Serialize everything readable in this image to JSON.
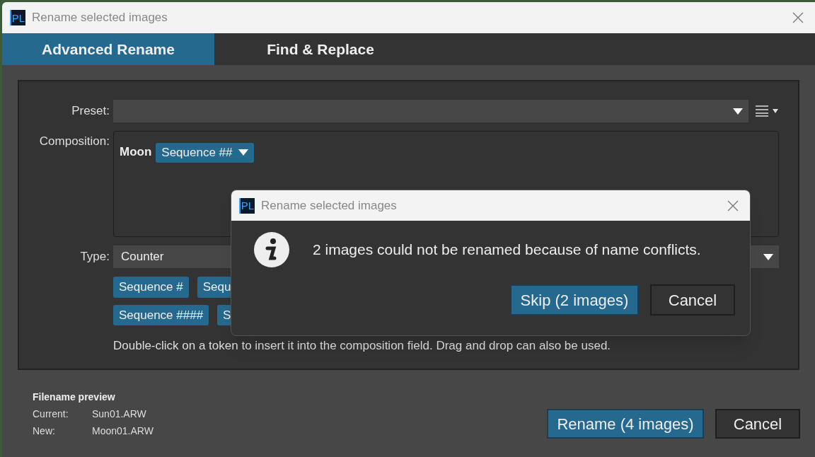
{
  "window": {
    "logo": "PL",
    "title": "Rename selected images"
  },
  "tabs": [
    {
      "label": "Advanced Rename",
      "selected": true
    },
    {
      "label": "Find & Replace",
      "selected": false
    }
  ],
  "preset": {
    "label": "Preset:"
  },
  "composition": {
    "label": "Composition:",
    "text": "Moon",
    "token": "Sequence ##"
  },
  "type": {
    "label": "Type:",
    "value": "Counter"
  },
  "tokens": [
    [
      "Sequence #",
      "Sequ"
    ],
    [
      "Sequence ####",
      "S"
    ]
  ],
  "hint": "Double-click on a token to insert it into the composition field. Drag and drop can also be used.",
  "preview": {
    "title": "Filename preview",
    "rows": [
      {
        "label": "Current:",
        "value": "Sun01.ARW"
      },
      {
        "label": "New:",
        "value": "Moon01.ARW"
      }
    ]
  },
  "buttons": [
    {
      "label": "Rename (4 images)",
      "primary": true
    },
    {
      "label": "Cancel",
      "primary": false
    }
  ],
  "dialog": {
    "logo": "PL",
    "title": "Rename selected images",
    "message": "2 images could not be renamed because of name conflicts.",
    "buttons": [
      {
        "label": "Skip (2 images)",
        "primary": true
      },
      {
        "label": "Cancel",
        "primary": false
      }
    ]
  }
}
